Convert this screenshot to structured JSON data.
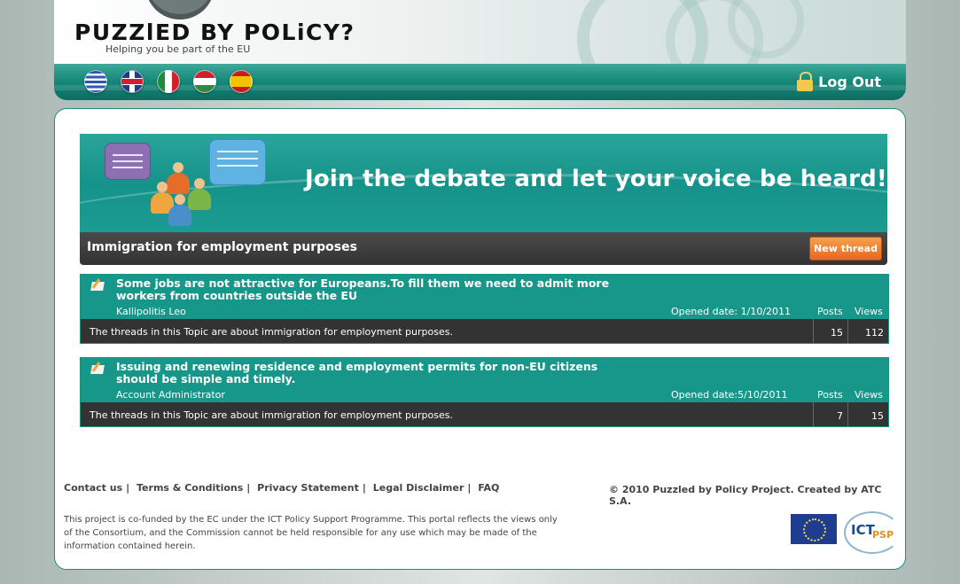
{
  "header": {
    "logo_title": "PUZZlED BY POLiCY?",
    "tagline": "Helping you be part of the EU",
    "languages": [
      "greek-flag",
      "uk-flag",
      "italian-flag",
      "hungarian-flag",
      "spanish-flag"
    ],
    "logout_label": "Log Out"
  },
  "banner": {
    "headline": "Join the debate and let your voice be heard!"
  },
  "topic": {
    "title": "Immigration for employment purposes",
    "new_thread_label": "New thread"
  },
  "threads": [
    {
      "title": "Some jobs are not attractive for Europeans.To fill them we need to admit more workers from countries outside the EU",
      "author": "Kallipolitis Leo",
      "opened": "Opened date: 1/10/2011",
      "posts_label": "Posts",
      "views_label": "Views",
      "description": "The threads in this Topic are about immigration for employment purposes.",
      "posts": "15",
      "views": "112"
    },
    {
      "title": "Issuing and renewing residence and employment permits for non-EU citizens should be simple and timely.",
      "author": "Account Administrator",
      "opened": "Opened date:5/10/2011",
      "posts_label": "Posts",
      "views_label": "Views",
      "description": "The threads in this Topic are about immigration for employment purposes.",
      "posts": "7",
      "views": "15"
    }
  ],
  "footer": {
    "links": [
      "Contact us",
      "Terms & Conditions",
      "Privacy Statement",
      "Legal Disclaimer",
      "FAQ"
    ],
    "copyright": "© 2010 Puzzled by Policy Project. Created by ATC S.A.",
    "disclaimer": "This project is co-funded by the EC under the ICT Policy Support Programme. This portal reflects the views only of the Consortium, and the Commission cannot be held responsible for any use which may be made of the information contained herein.",
    "ict_logo_text": "ICT",
    "ict_logo_sub": "PSP"
  },
  "colors": {
    "teal": "#17968a",
    "dark": "#333333",
    "orange": "#e8661f"
  }
}
